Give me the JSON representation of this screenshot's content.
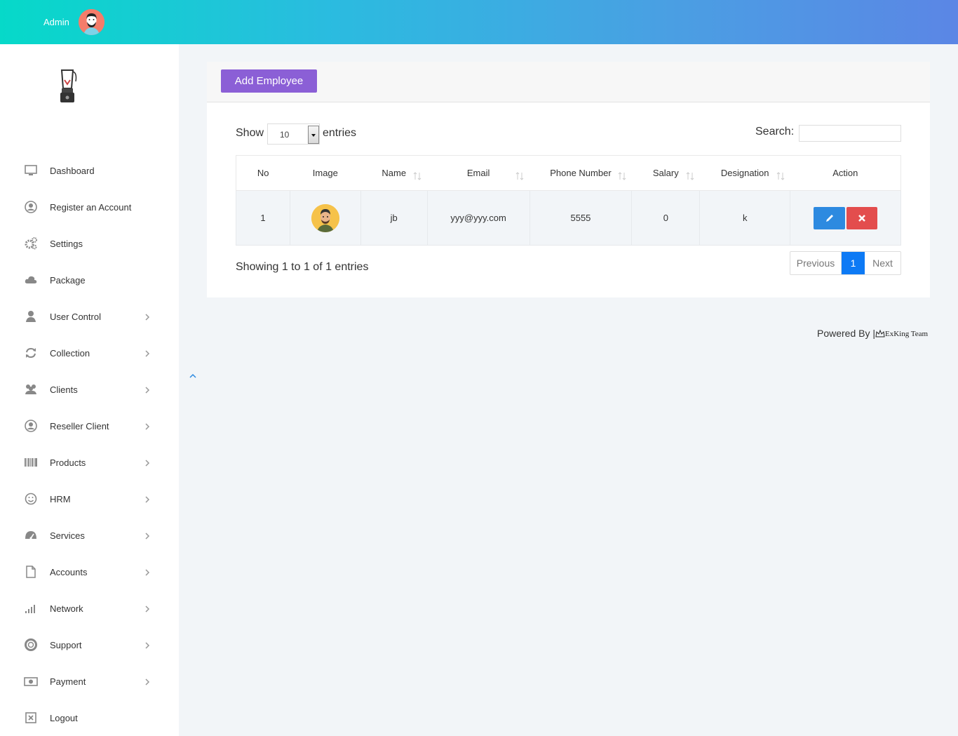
{
  "header": {
    "user_label": "Admin",
    "accent_gradient": [
      "#06d9c9",
      "#5b86e5"
    ]
  },
  "sidebar": {
    "items": [
      {
        "label": "Dashboard",
        "icon": "monitor-icon",
        "has_submenu": false
      },
      {
        "label": "Register an Account",
        "icon": "user-circle-icon",
        "has_submenu": false
      },
      {
        "label": "Settings",
        "icon": "gears-icon",
        "has_submenu": false
      },
      {
        "label": "Package",
        "icon": "cloud-icon",
        "has_submenu": false
      },
      {
        "label": "User Control",
        "icon": "user-icon",
        "has_submenu": true
      },
      {
        "label": "Collection",
        "icon": "refresh-icon",
        "has_submenu": true
      },
      {
        "label": "Clients",
        "icon": "users-icon",
        "has_submenu": true
      },
      {
        "label": "Reseller Client",
        "icon": "user-circle-icon",
        "has_submenu": true
      },
      {
        "label": "Products",
        "icon": "barcode-icon",
        "has_submenu": true
      },
      {
        "label": "HRM",
        "icon": "smile-icon",
        "has_submenu": true
      },
      {
        "label": "Services",
        "icon": "dashboard-gauge-icon",
        "has_submenu": true
      },
      {
        "label": "Accounts",
        "icon": "file-icon",
        "has_submenu": true
      },
      {
        "label": "Network",
        "icon": "signal-icon",
        "has_submenu": true
      },
      {
        "label": "Support",
        "icon": "life-ring-icon",
        "has_submenu": true
      },
      {
        "label": "Payment",
        "icon": "money-icon",
        "has_submenu": true
      },
      {
        "label": "Logout",
        "icon": "close-box-icon",
        "has_submenu": false
      }
    ]
  },
  "main": {
    "add_button": "Add Employee",
    "show_label": "Show",
    "page_length": "10",
    "entries_label": "entries",
    "search_label": "Search:",
    "search_value": "",
    "table": {
      "columns": [
        "No",
        "Image",
        "Name",
        "Email",
        "Phone Number",
        "Salary",
        "Designation",
        "Action"
      ],
      "rows": [
        {
          "no": "1",
          "name": "jb",
          "email": "yyy@yyy.com",
          "phone": "5555",
          "salary": "0",
          "designation": "k"
        }
      ]
    },
    "info": "Showing 1 to 1 of 1 entries",
    "pagination": {
      "previous": "Previous",
      "current": "1",
      "next": "Next"
    }
  },
  "footer": {
    "powered_by": "Powered By |",
    "brand": "ExKing Team"
  },
  "colors": {
    "add_button": "#8b5fd6",
    "edit_button": "#2d8ae0",
    "delete_button": "#e34d4d",
    "active_page": "#0d7af5"
  }
}
